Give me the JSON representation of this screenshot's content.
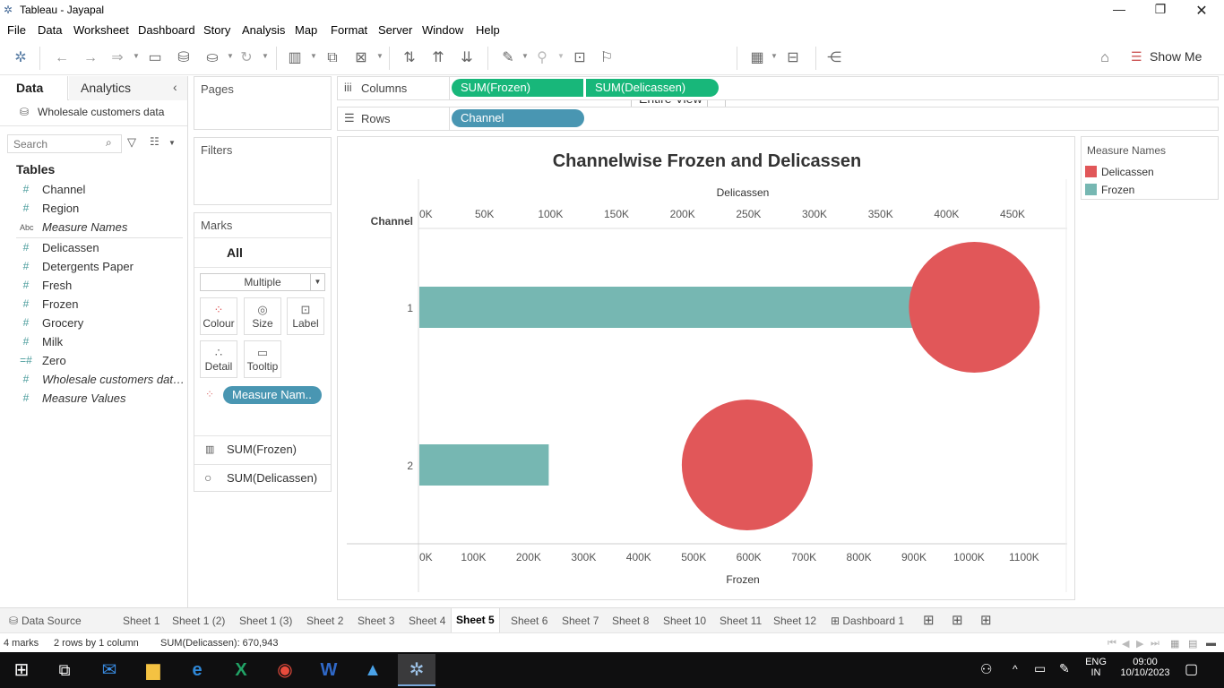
{
  "window": {
    "title": "Tableau - Jayapal"
  },
  "menu": [
    "File",
    "Data",
    "Worksheet",
    "Dashboard",
    "Story",
    "Analysis",
    "Map",
    "Format",
    "Server",
    "Window",
    "Help"
  ],
  "toolbar": {
    "fit_value": "Entire View",
    "show_me": "Show Me"
  },
  "data_pane": {
    "tab_data": "Data",
    "tab_analytics": "Analytics",
    "datasource": "Wholesale customers data",
    "search_placeholder": "Search",
    "tables_heading": "Tables",
    "fields": [
      {
        "icon": "#",
        "label": "Channel",
        "italic": false
      },
      {
        "icon": "#",
        "label": "Region",
        "italic": false
      },
      {
        "icon": "Abc",
        "label": "Measure Names",
        "italic": true
      },
      {
        "icon": "#",
        "label": "Delicassen",
        "italic": false
      },
      {
        "icon": "#",
        "label": "Detergents Paper",
        "italic": false
      },
      {
        "icon": "#",
        "label": "Fresh",
        "italic": false
      },
      {
        "icon": "#",
        "label": "Frozen",
        "italic": false
      },
      {
        "icon": "#",
        "label": "Grocery",
        "italic": false
      },
      {
        "icon": "#",
        "label": "Milk",
        "italic": false
      },
      {
        "icon": "=#",
        "label": "Zero",
        "italic": false
      },
      {
        "icon": "#",
        "label": "Wholesale customers dat…",
        "italic": true
      },
      {
        "icon": "#",
        "label": "Measure Values",
        "italic": true
      }
    ]
  },
  "cards": {
    "pages": "Pages",
    "filters": "Filters",
    "marks": "Marks",
    "marks_all": "All",
    "mark_type": "Multiple",
    "buttons": [
      "Colour",
      "Size",
      "Label",
      "Detail",
      "Tooltip"
    ],
    "color_pill": "Measure Nam..",
    "measure_rows": [
      "SUM(Frozen)",
      "SUM(Delicassen)"
    ]
  },
  "shelves": {
    "columns_label": "Columns",
    "rows_label": "Rows",
    "columns_pills": [
      "SUM(Frozen)",
      "SUM(Delicassen)"
    ],
    "rows_pills": [
      "Channel"
    ]
  },
  "legend": {
    "title": "Measure Names",
    "items": [
      {
        "label": "Delicassen",
        "color": "#e15759"
      },
      {
        "label": "Frozen",
        "color": "#76b7b2"
      }
    ]
  },
  "chart_data": {
    "type": "bar",
    "title": "Channelwise Frozen and Delicassen",
    "row_header": "Channel",
    "categories": [
      "1",
      "2"
    ],
    "frozen_axis": {
      "label": "Frozen",
      "ticks": [
        "0K",
        "100K",
        "200K",
        "300K",
        "400K",
        "500K",
        "600K",
        "700K",
        "800K",
        "900K",
        "1000K",
        "1100K"
      ],
      "range": [
        0,
        1175000
      ]
    },
    "delicassen_axis": {
      "label": "Delicassen",
      "ticks": [
        "0K",
        "50K",
        "100K",
        "150K",
        "200K",
        "250K",
        "300K",
        "350K",
        "400K",
        "450K"
      ],
      "range": [
        0,
        490000
      ]
    },
    "series": [
      {
        "name": "Frozen",
        "mark": "bar",
        "values": [
          900000,
          235000
        ],
        "color": "#76b7b2"
      },
      {
        "name": "Delicassen",
        "mark": "circle",
        "values": [
          421000,
          249000
        ],
        "color": "#e15759"
      }
    ]
  },
  "sheets": {
    "data_source": "Data Source",
    "tabs": [
      "Sheet 1",
      "Sheet 1 (2)",
      "Sheet 1 (3)",
      "Sheet 2",
      "Sheet 3",
      "Sheet 4",
      "Sheet 5",
      "Sheet 6",
      "Sheet 7",
      "Sheet 8",
      "Sheet 10",
      "Sheet 11",
      "Sheet 12",
      "Dashboard 1"
    ],
    "active": "Sheet 5"
  },
  "status": {
    "marks": "4 marks",
    "dims": "2 rows  by  1 column",
    "sum": "SUM(Delicassen): 670,943"
  },
  "taskbar": {
    "lang1": "ENG",
    "lang2": "IN",
    "time": "09:00",
    "date": "10/10/2023"
  }
}
